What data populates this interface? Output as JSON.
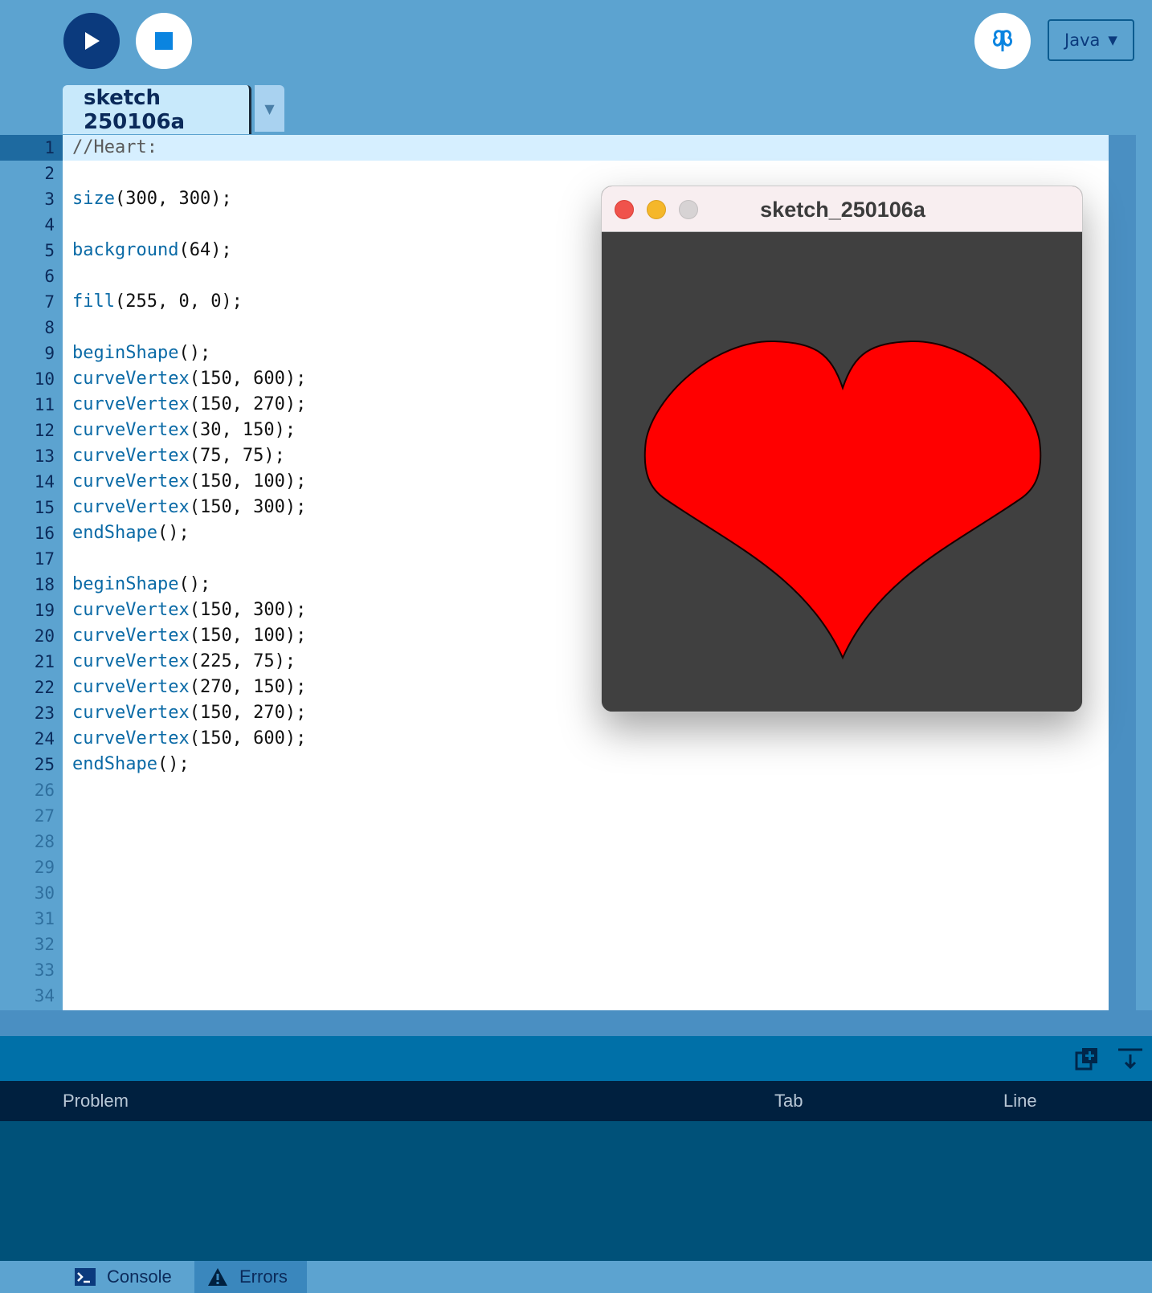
{
  "toolbar": {
    "run_icon": "play-icon",
    "stop_icon": "stop-icon",
    "debug_icon": "butterfly-debug-icon",
    "mode": "Java",
    "mode_caret": "▼"
  },
  "tabs": [
    {
      "label": "sketch 250106a"
    }
  ],
  "tab_menu_icon": "▼",
  "editor": {
    "current_line": 1,
    "line_numbers": [
      "1",
      "2",
      "3",
      "4",
      "5",
      "6",
      "7",
      "8",
      "9",
      "10",
      "11",
      "12",
      "13",
      "14",
      "15",
      "16",
      "17",
      "18",
      "19",
      "20",
      "21",
      "22",
      "23",
      "24",
      "25",
      "26",
      "27",
      "28",
      "29",
      "30",
      "31",
      "32",
      "33",
      "34"
    ],
    "lines": [
      "//Heart:",
      "",
      "size(300, 300);",
      "",
      "background(64);",
      "",
      "fill(255, 0, 0);",
      "",
      "beginShape();",
      "curveVertex(150, 600);",
      "curveVertex(150, 270);",
      "curveVertex(30, 150);",
      "curveVertex(75, 75);",
      "curveVertex(150, 100);",
      "curveVertex(150, 300);",
      "endShape();",
      "",
      "beginShape();",
      "curveVertex(150, 300);",
      "curveVertex(150, 100);",
      "curveVertex(225, 75);",
      "curveVertex(270, 150);",
      "curveVertex(150, 270);",
      "curveVertex(150, 600);",
      "endShape();"
    ]
  },
  "sketch_window": {
    "title": "sketch_250106a",
    "background": "#404040",
    "fill": "#ff0000"
  },
  "console_panel": {
    "columns": {
      "problem": "Problem",
      "tab": "Tab",
      "line": "Line"
    },
    "tabs": [
      {
        "label": "Console",
        "icon": "terminal-icon"
      },
      {
        "label": "Errors",
        "icon": "warning-icon"
      }
    ]
  }
}
